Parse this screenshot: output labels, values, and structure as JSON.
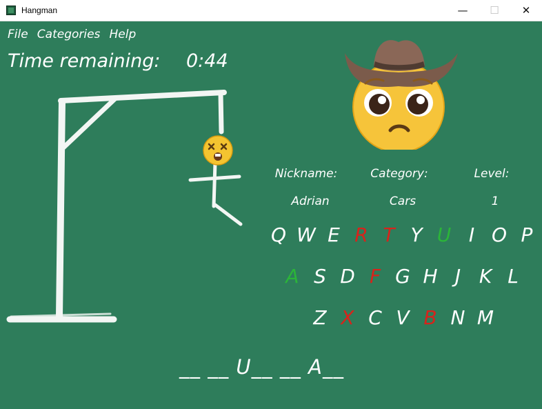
{
  "window": {
    "title": "Hangman",
    "minimize_glyph": "—",
    "maximize_glyph": "☐",
    "close_glyph": "✕"
  },
  "menu": {
    "items": [
      {
        "label": "File"
      },
      {
        "label": "Categories"
      },
      {
        "label": "Help"
      }
    ]
  },
  "timer": {
    "label": "Time remaining:",
    "value": "0:44"
  },
  "player": {
    "nickname_label": "Nickname:",
    "nickname": "Adrian",
    "category_label": "Category:",
    "category": "Cars",
    "level_label": "Level:",
    "level": "1"
  },
  "keyboard": {
    "rows": [
      [
        {
          "letter": "Q",
          "state": "unused"
        },
        {
          "letter": "W",
          "state": "unused"
        },
        {
          "letter": "E",
          "state": "unused"
        },
        {
          "letter": "R",
          "state": "wrong"
        },
        {
          "letter": "T",
          "state": "wrong"
        },
        {
          "letter": "Y",
          "state": "unused"
        },
        {
          "letter": "U",
          "state": "right"
        },
        {
          "letter": "I",
          "state": "unused"
        },
        {
          "letter": "O",
          "state": "unused"
        },
        {
          "letter": "P",
          "state": "unused"
        }
      ],
      [
        {
          "letter": "A",
          "state": "right"
        },
        {
          "letter": "S",
          "state": "unused"
        },
        {
          "letter": "D",
          "state": "unused"
        },
        {
          "letter": "F",
          "state": "wrong"
        },
        {
          "letter": "G",
          "state": "unused"
        },
        {
          "letter": "H",
          "state": "unused"
        },
        {
          "letter": "J",
          "state": "unused"
        },
        {
          "letter": "K",
          "state": "unused"
        },
        {
          "letter": "L",
          "state": "unused"
        }
      ],
      [
        {
          "letter": "Z",
          "state": "unused"
        },
        {
          "letter": "X",
          "state": "wrong"
        },
        {
          "letter": "C",
          "state": "unused"
        },
        {
          "letter": "V",
          "state": "unused"
        },
        {
          "letter": "B",
          "state": "wrong"
        },
        {
          "letter": "N",
          "state": "unused"
        },
        {
          "letter": "M",
          "state": "unused"
        }
      ]
    ]
  },
  "word": {
    "display": "__ __ U__ __ A__"
  },
  "colors": {
    "board": "#2e7d5b",
    "chalk": "#ffffff",
    "wrong": "#d8231b",
    "right": "#2bb539"
  },
  "icons": {
    "app": "hangman-app-icon",
    "cowboy_emoji": "pleading-cowboy-emoji",
    "dead_face_emoji": "dizzy-dead-face-emoji"
  }
}
